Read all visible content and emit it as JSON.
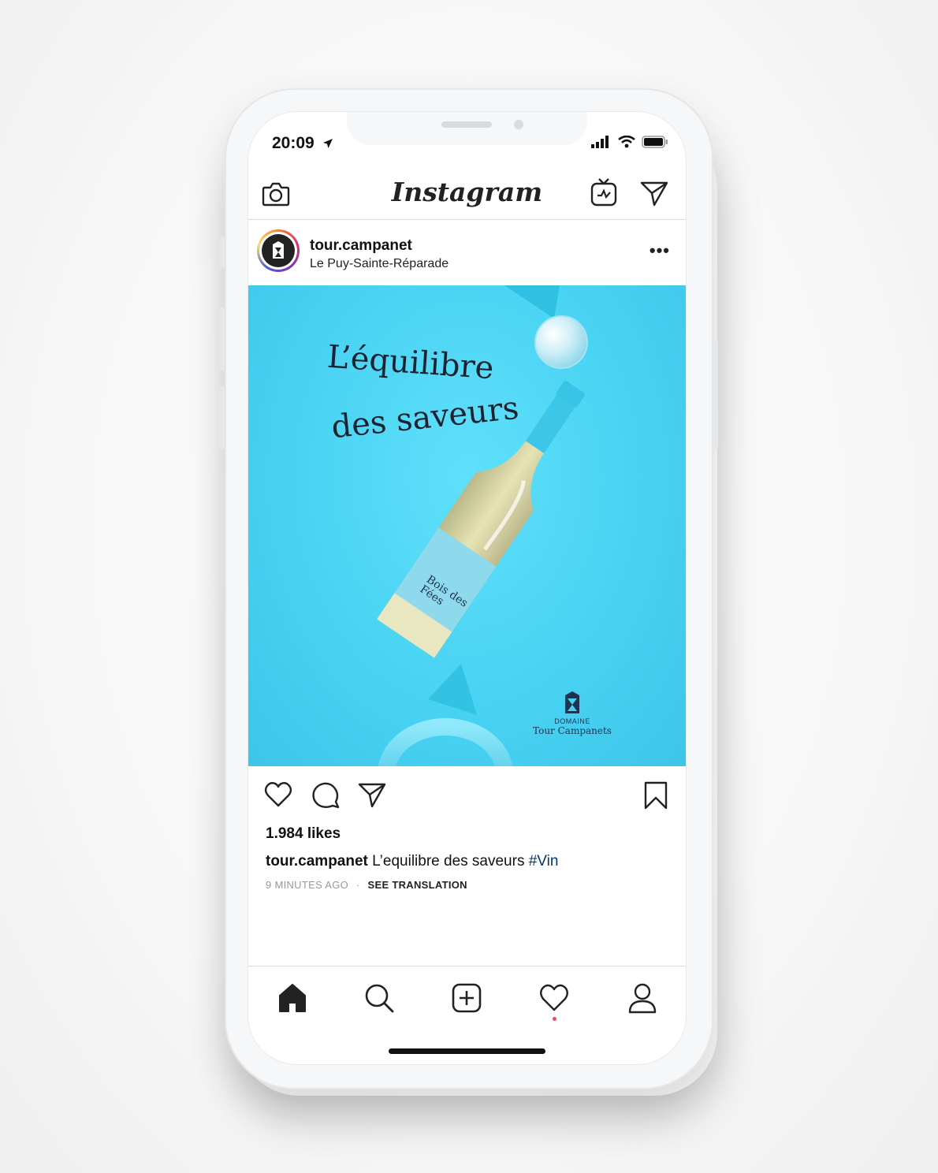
{
  "status": {
    "time": "20:09"
  },
  "app": {
    "title": "Instagram"
  },
  "post": {
    "username": "tour.campanet",
    "location": "Le Puy-Sainte-Réparade",
    "more_label": "•••",
    "image": {
      "headline_line1": "L’équilibre",
      "headline_line2": "des saveurs",
      "bottle_label_line1": "Bois des",
      "bottle_label_line2": "Fées",
      "brand_small": "DOMAINE",
      "brand_name": "Tour Campanets"
    },
    "likes": "1.984 likes",
    "caption_user": "tour.campanet",
    "caption_text": " L’equilibre des saveurs ",
    "caption_tag": "#Vin",
    "time_ago": "9 MINUTES AGO",
    "separator": "·",
    "see_translation": "SEE TRANSLATION"
  },
  "icons": {
    "top_left": "camera-icon",
    "top_right_1": "igtv-icon",
    "top_right_2": "direct-message-icon",
    "actions": [
      "heart-icon",
      "comment-icon",
      "share-icon",
      "bookmark-icon"
    ],
    "tabs": [
      "home-icon",
      "search-icon",
      "add-post-icon",
      "activity-heart-icon",
      "profile-icon"
    ]
  },
  "colors": {
    "post_background": "#47d1f2",
    "hashtag": "#003569",
    "notification_dot": "#ed4956"
  }
}
